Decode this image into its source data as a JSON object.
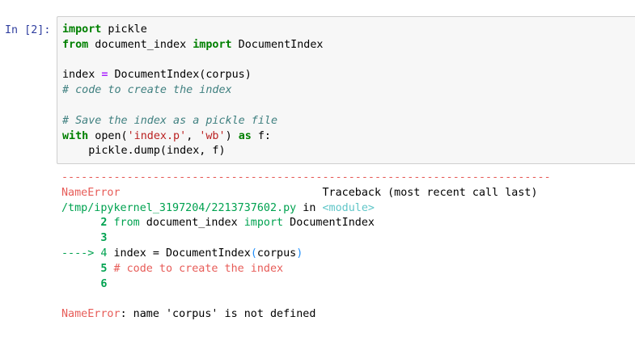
{
  "cell": {
    "prompt": "In [2]:",
    "code": {
      "l1_kw": "import",
      "l1_rest": " pickle",
      "l2_kw1": "from",
      "l2_mid": " document_index ",
      "l2_kw2": "import",
      "l2_rest": " DocumentIndex",
      "l4_a": "index ",
      "l4_op": "=",
      "l4_b": " DocumentIndex(corpus)",
      "l5_comment": "# code to create the index",
      "l7_comment": "# Save the index as a pickle file",
      "l8_kw": "with",
      "l8_a": " open(",
      "l8_s1": "'index.p'",
      "l8_b": ", ",
      "l8_s2": "'wb'",
      "l8_c": ") ",
      "l8_kw2": "as",
      "l8_d": " f:",
      "l9": "    pickle.dump(index, f)"
    }
  },
  "output": {
    "separator": "---------------------------------------------------------------------------",
    "error_name": "NameError",
    "traceback_header": "Traceback (most recent call last)",
    "file_path": "/tmp/ipykernel_3197204/2213737602.py",
    "in_word": " in ",
    "module_tag": "<module>",
    "tb_line2_num": "      2 ",
    "tb_line2_kw1": "from",
    "tb_line2_mid": " document_index ",
    "tb_line2_kw2": "import",
    "tb_line2_rest": " DocumentIndex",
    "tb_line3_num": "      3",
    "tb_arrow": "----> 4 ",
    "tb_line4_a": "index ",
    "tb_line4_op": "=",
    "tb_line4_b": " DocumentIndex",
    "tb_line4_paren_open": "(",
    "tb_line4_arg": "corpus",
    "tb_line4_paren_close": ")",
    "tb_line5_num": "      5 ",
    "tb_line5_comment": "# code to create the index",
    "tb_line6_num": "      6",
    "final_error_name": "NameError",
    "final_error_msg": ": name 'corpus' is not defined"
  }
}
